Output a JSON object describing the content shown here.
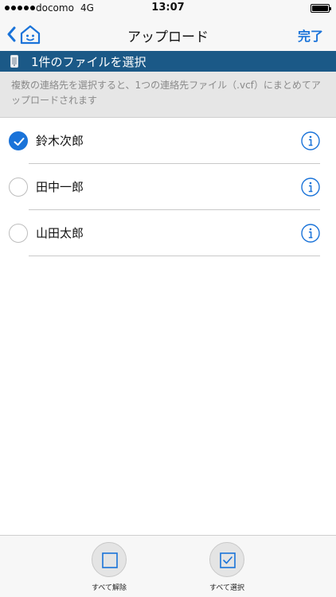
{
  "status_bar": {
    "carrier": "docomo",
    "network": "4G",
    "time": "13:07",
    "battery_level": 1.0
  },
  "nav": {
    "back_icon": "chevron-left-icon",
    "home_icon": "home-face-icon",
    "title": "アップロード",
    "done_label": "完了"
  },
  "selection": {
    "icon": "phone-icon",
    "text": "1件のファイルを選択"
  },
  "info_text": "複数の連絡先を選択すると、1つの連絡先ファイル（.vcf）にまとめてアップロードされます",
  "contacts": [
    {
      "name": "鈴木次郎",
      "selected": true
    },
    {
      "name": "田中一郎",
      "selected": false
    },
    {
      "name": "山田太郎",
      "selected": false
    }
  ],
  "toolbar": {
    "deselect_all_label": "すべて解除",
    "select_all_label": "すべて選択"
  },
  "colors": {
    "accent": "#1a73d9",
    "header_band": "#1b5987",
    "banner_bg": "#e6e6e6"
  }
}
